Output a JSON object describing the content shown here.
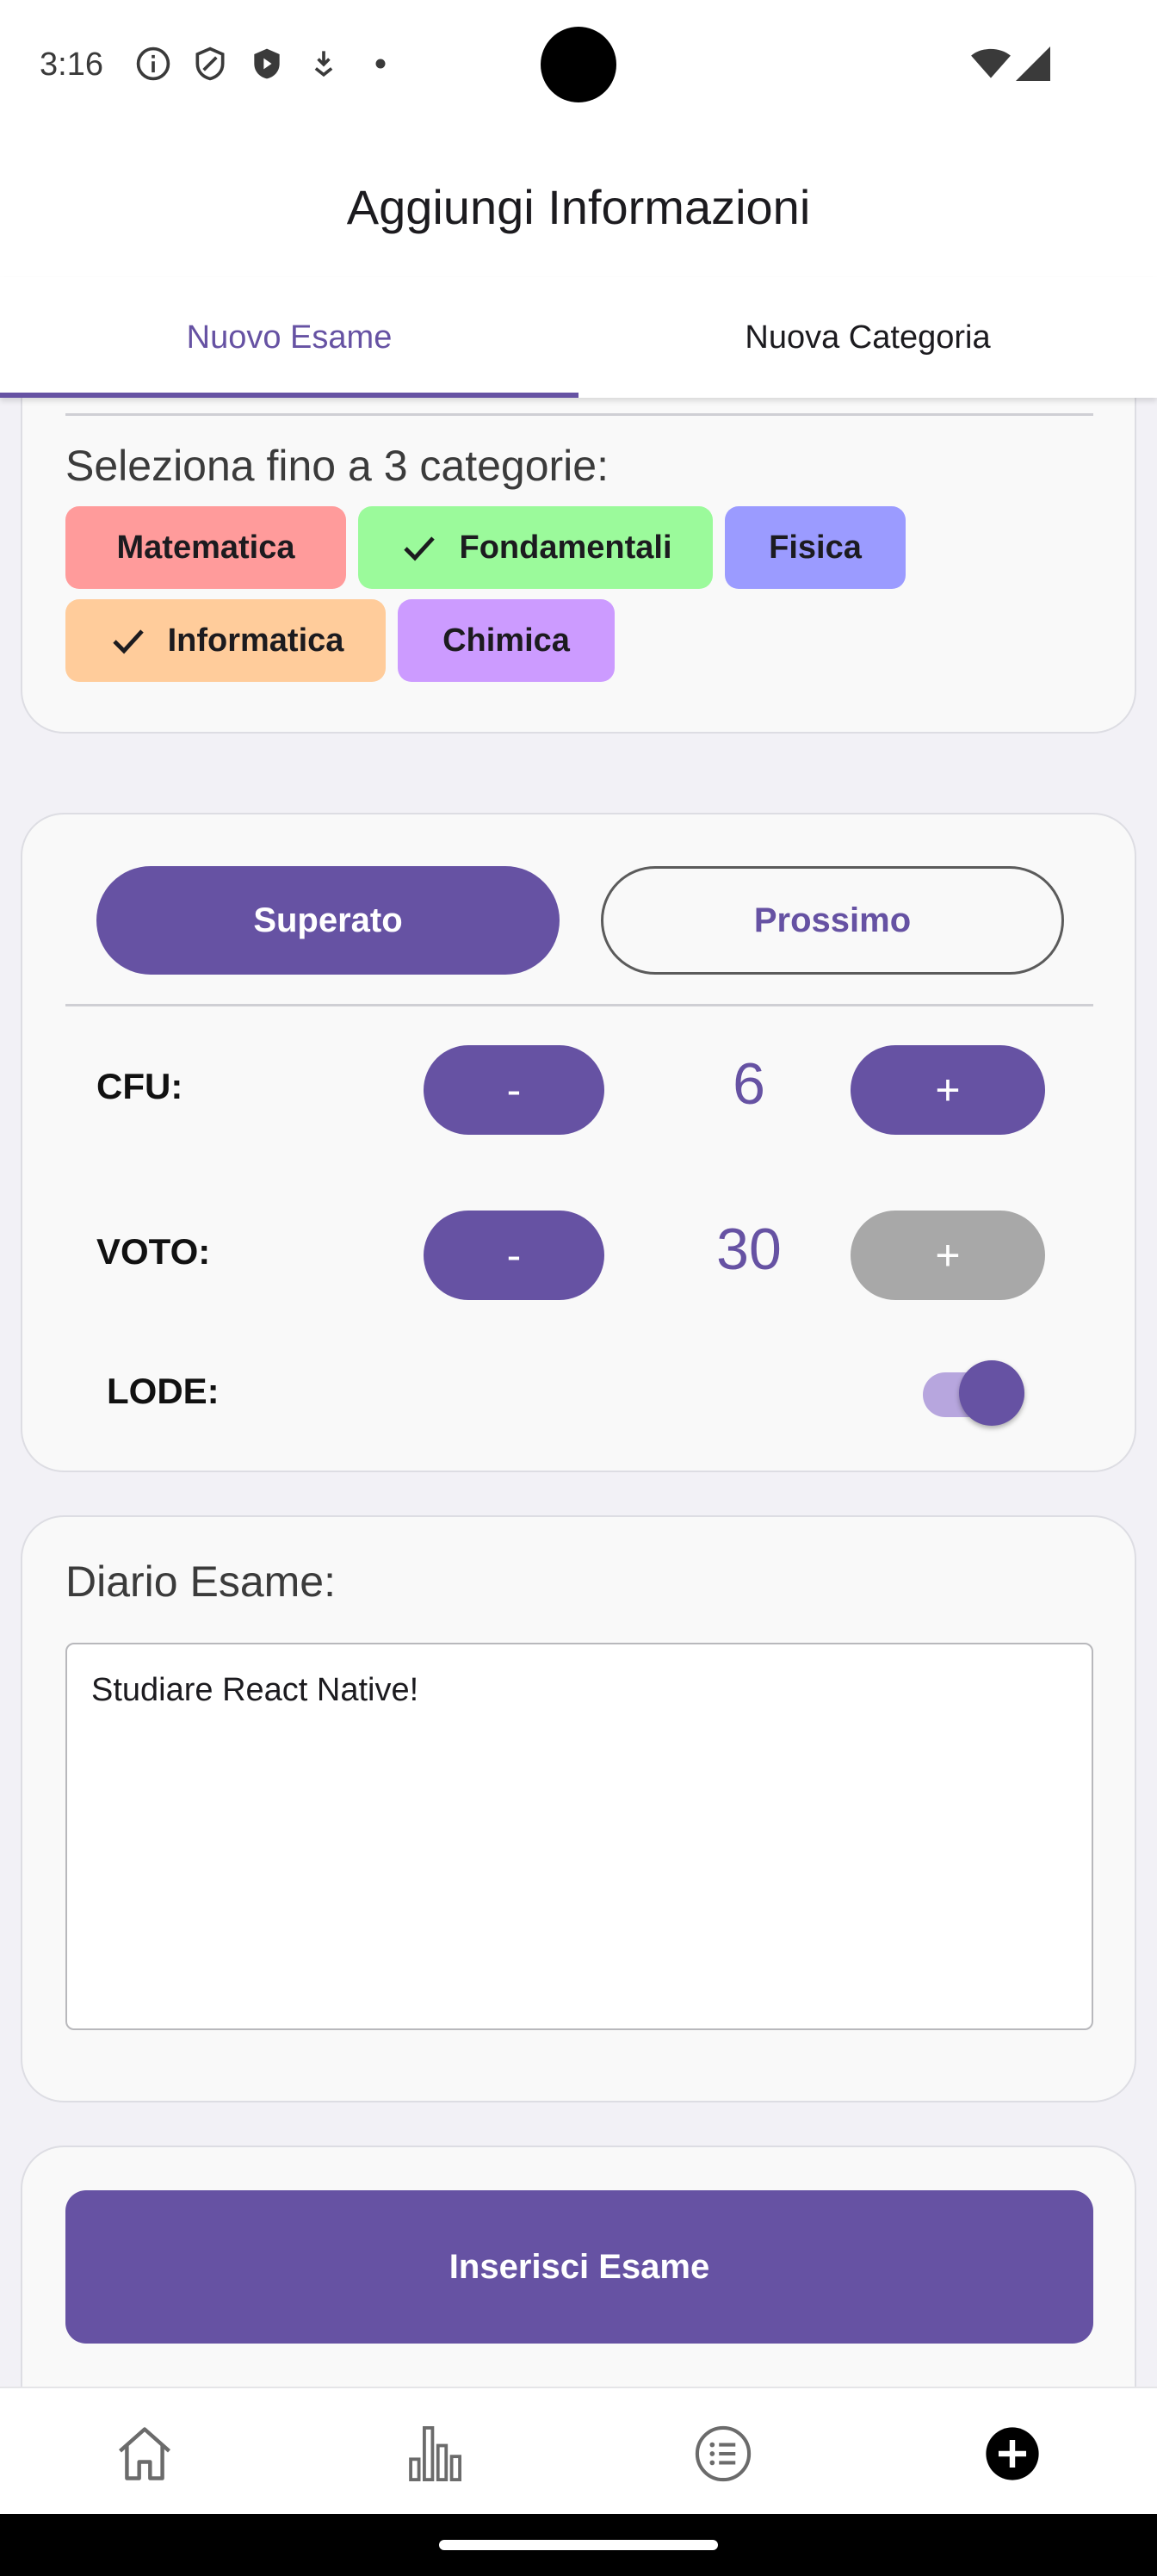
{
  "status_bar": {
    "time": "3:16",
    "icons": [
      "info-icon",
      "shield-icon",
      "play-protect-icon",
      "download-icon",
      "dot-icon",
      "wifi-icon",
      "signal-icon"
    ]
  },
  "header": {
    "title": "Aggiungi Informazioni"
  },
  "tabs": [
    {
      "label": "Nuovo Esame",
      "active": true
    },
    {
      "label": "Nuova Categoria",
      "active": false
    }
  ],
  "categories_section": {
    "title": "Seleziona fino a 3 categorie:",
    "chips": [
      {
        "label": "Matematica",
        "selected": false,
        "color": "#ff9b9b"
      },
      {
        "label": "Fondamentali",
        "selected": true,
        "color": "#9bfa9b"
      },
      {
        "label": "Fisica",
        "selected": false,
        "color": "#9b9bff"
      },
      {
        "label": "Informatica",
        "selected": true,
        "color": "#ffcc9b"
      },
      {
        "label": "Chimica",
        "selected": false,
        "color": "#cc9bff"
      }
    ]
  },
  "exam_section": {
    "status_options": [
      {
        "label": "Superato",
        "selected": true
      },
      {
        "label": "Prossimo",
        "selected": false
      }
    ],
    "cfu": {
      "label": "CFU:",
      "minus": "-",
      "value": "6",
      "plus": "+"
    },
    "voto": {
      "label": "VOTO:",
      "minus": "-",
      "value": "30",
      "plus": "+",
      "plus_disabled": true
    },
    "lode": {
      "label": "LODE:",
      "enabled": true
    }
  },
  "diary_section": {
    "title": "Diario Esame:",
    "text": "Studiare React Native!"
  },
  "submit": {
    "label": "Inserisci Esame"
  },
  "bottom_nav": {
    "items": [
      {
        "icon": "home-icon",
        "active": false
      },
      {
        "icon": "bar-chart-icon",
        "active": false
      },
      {
        "icon": "list-icon",
        "active": false
      },
      {
        "icon": "add-circle-icon",
        "active": true
      }
    ]
  },
  "colors": {
    "primary": "#6652a3",
    "disabled": "#a8a8a8",
    "card_bg": "#f9f9f9",
    "page_bg": "#f2f1f6"
  }
}
